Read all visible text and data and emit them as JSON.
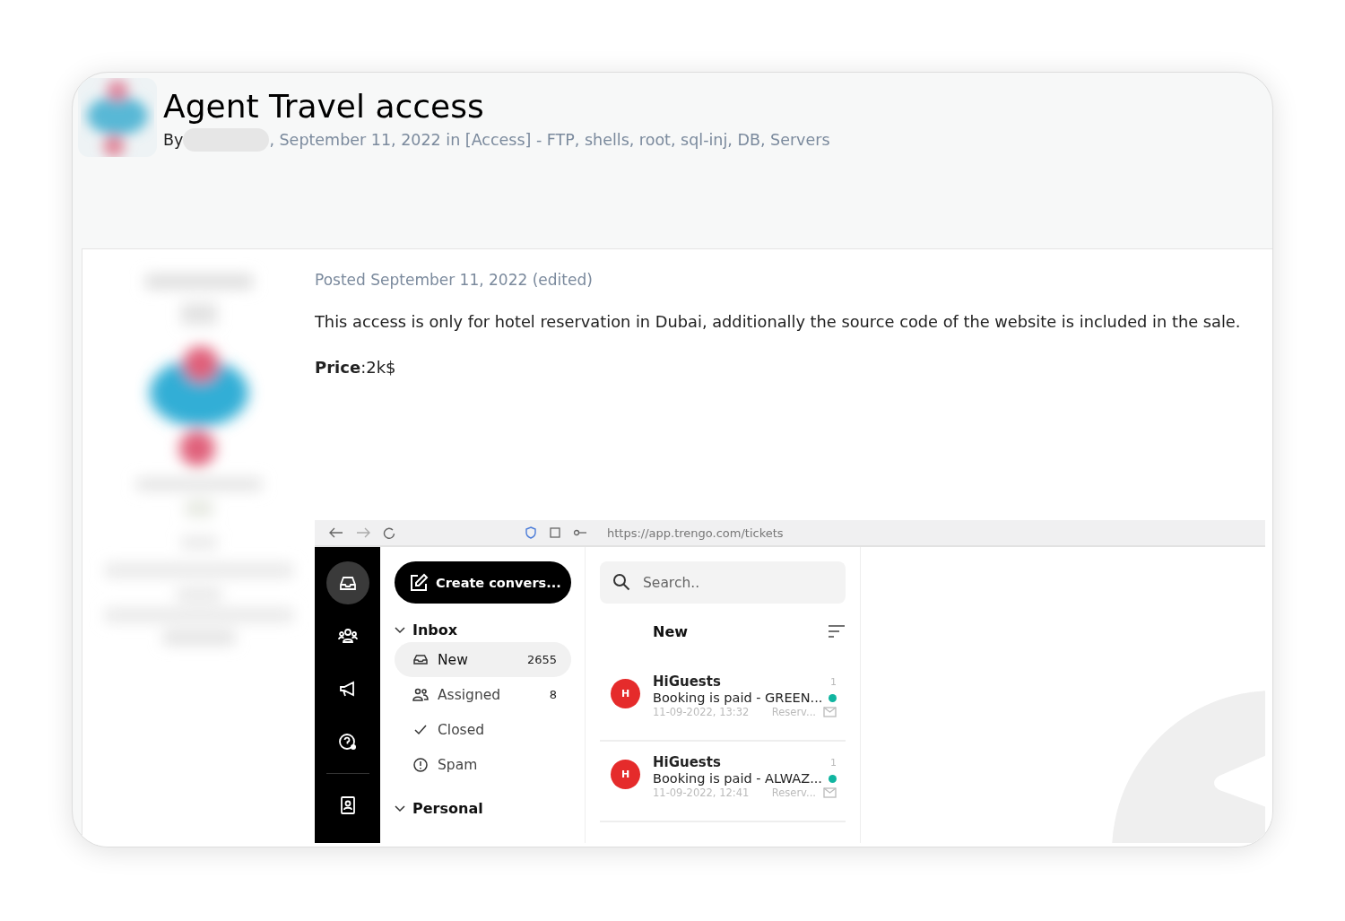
{
  "thread": {
    "title": "Agent Travel access",
    "by": "By",
    "meta": ", September 11, 2022 in [Access] - FTP, shells, root, sql-inj, DB, Servers"
  },
  "post": {
    "posted": "Posted September 11, 2022 (edited)",
    "body": "This access is only for hotel reservation in Dubai, additionally the source code of the website is included in the sale.",
    "price": "**Price**:2k$"
  },
  "embedded_screenshot": {
    "url": "https://app.trengo.com/tickets",
    "rail": [
      {
        "selected": true
      },
      {
        "selected": false
      },
      {
        "selected": false
      },
      {
        "selected": false
      },
      {
        "selected": false
      }
    ],
    "create_button": "Create convers...",
    "sections": [
      {
        "label": "Inbox",
        "expanded": true,
        "items": [
          {
            "label": "New",
            "count": "2655",
            "selected": true
          },
          {
            "label": "Assigned",
            "count": "8",
            "selected": false
          },
          {
            "label": "Closed",
            "selected": false
          },
          {
            "label": "Spam",
            "selected": false
          }
        ]
      },
      {
        "label": "Personal",
        "expanded": true
      }
    ],
    "search": {
      "placeholder": "Search.."
    },
    "list_title": "New",
    "tickets": [
      {
        "avatar": "H",
        "name": "HiGuests",
        "count": "1",
        "subject": "Booking is paid - GREEN...",
        "unread": true,
        "time": "11-09-2022, 13:32",
        "channel": "Reserv..."
      },
      {
        "avatar": "H",
        "name": "HiGuests",
        "count": "1",
        "subject": "Booking is paid - ALWAZ...",
        "unread": true,
        "time": "11-09-2022, 12:41",
        "channel": "Reserv..."
      }
    ]
  }
}
